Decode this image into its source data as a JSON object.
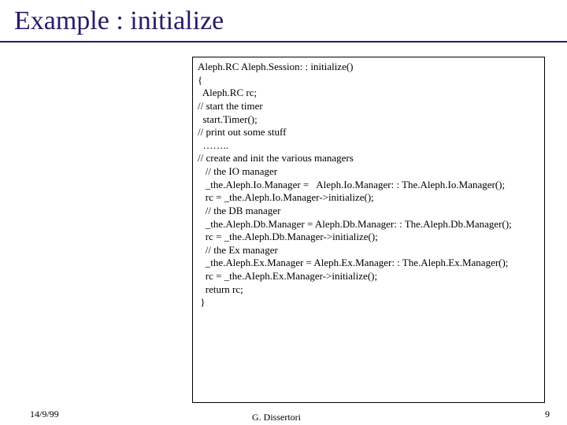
{
  "title": "Example : initialize",
  "code_lines": [
    "Aleph.RC Aleph.Session: : initialize()",
    "{",
    "  Aleph.RC rc;",
    "",
    "// start the timer",
    "  start.Timer();",
    "",
    "// print out some stuff",
    "  ……..",
    "// create and init the various managers",
    "",
    "   // the IO manager",
    "   _the.Aleph.Io.Manager =   Aleph.Io.Manager: : The.Aleph.Io.Manager();",
    "   rc = _the.Aleph.Io.Manager->initialize();",
    "",
    "   // the DB manager",
    "   _the.Aleph.Db.Manager = Aleph.Db.Manager: : The.Aleph.Db.Manager();",
    "   rc = _the.Aleph.Db.Manager->initialize();",
    "",
    "   // the Ex manager",
    "   _the.Aleph.Ex.Manager = Aleph.Ex.Manager: : The.Aleph.Ex.Manager();",
    "   rc = _the.AIeph.Ex.Manager->initialize();",
    "",
    "   return rc;",
    " }"
  ],
  "footer": {
    "date": "14/9/99",
    "author": "G. Dissertori",
    "page": "9"
  }
}
